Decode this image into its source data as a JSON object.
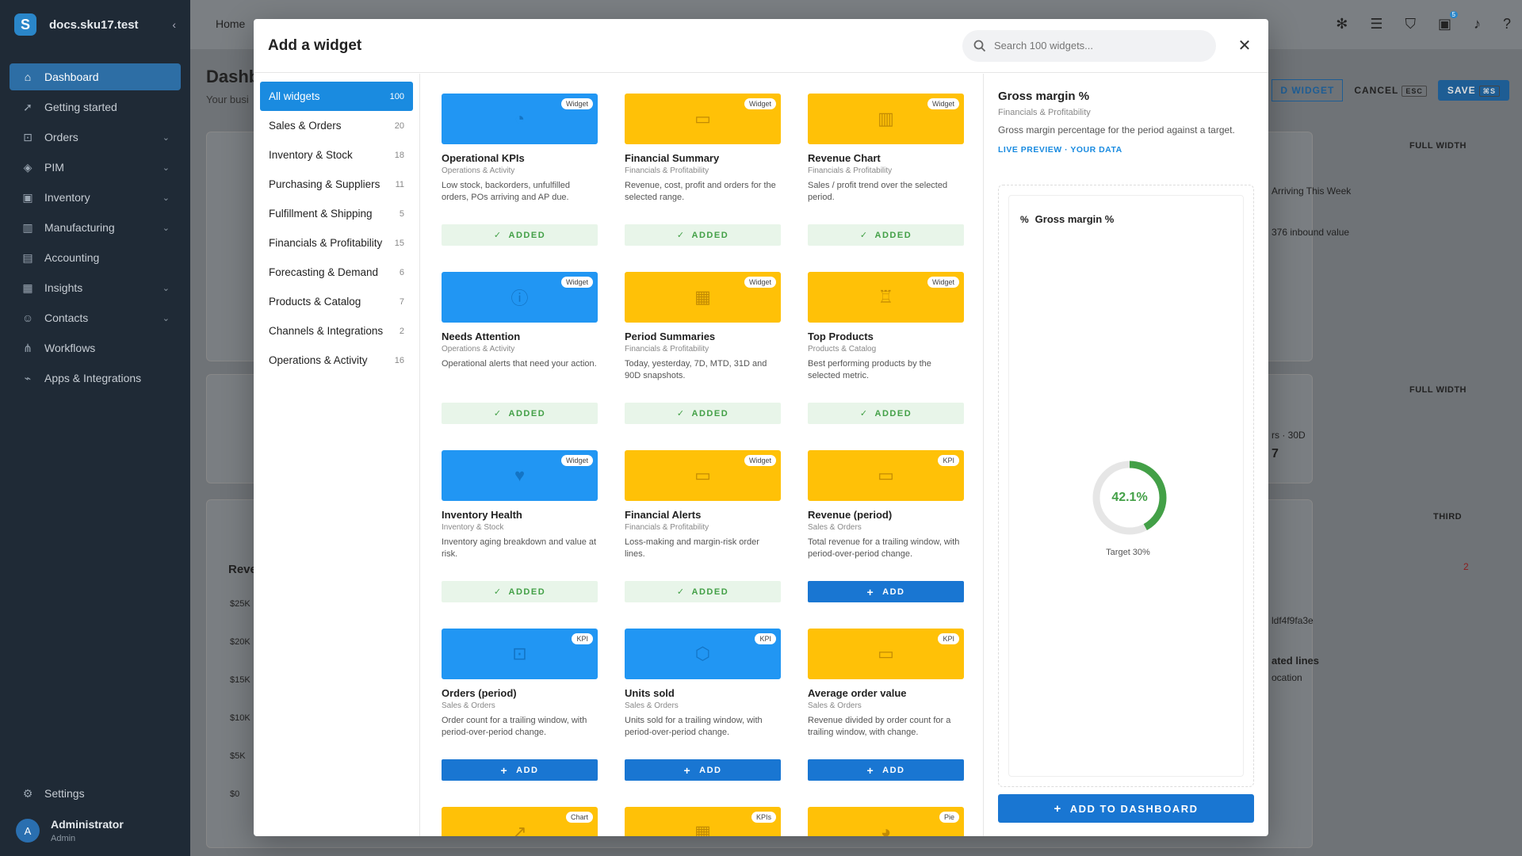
{
  "sidebar": {
    "brand": "docs.sku17.test",
    "items": [
      {
        "label": "Dashboard",
        "icon": "home-icon",
        "glyph": "⌂",
        "chevron": false
      },
      {
        "label": "Getting started",
        "icon": "rocket-icon",
        "glyph": "➚",
        "chevron": false
      },
      {
        "label": "Orders",
        "icon": "cart-icon",
        "glyph": "⊡",
        "chevron": true
      },
      {
        "label": "PIM",
        "icon": "tag-icon",
        "glyph": "◈",
        "chevron": true
      },
      {
        "label": "Inventory",
        "icon": "box-icon",
        "glyph": "▣",
        "chevron": true
      },
      {
        "label": "Manufacturing",
        "icon": "factory-icon",
        "glyph": "▥",
        "chevron": true
      },
      {
        "label": "Accounting",
        "icon": "book-icon",
        "glyph": "▤",
        "chevron": false
      },
      {
        "label": "Insights",
        "icon": "chart-icon",
        "glyph": "▦",
        "chevron": true
      },
      {
        "label": "Contacts",
        "icon": "contacts-icon",
        "glyph": "☺",
        "chevron": true
      },
      {
        "label": "Workflows",
        "icon": "workflow-icon",
        "glyph": "⋔",
        "chevron": false
      },
      {
        "label": "Apps & Integrations",
        "icon": "plug-icon",
        "glyph": "⌁",
        "chevron": false
      }
    ],
    "settings": "Settings",
    "user": {
      "initial": "A",
      "name": "Administrator",
      "role": "Admin"
    }
  },
  "background": {
    "breadcrumb": "Home",
    "title": "Dashb",
    "subtitle": "Your busi",
    "add_widget": "D WIDGET",
    "cancel": "CANCEL",
    "cancel_key": "ESC",
    "save": "SAVE",
    "save_key": "⌘S",
    "full_width": "FULL WIDTH",
    "third": "THIRD",
    "arriving": "Arriving This Week",
    "inbound": "376 inbound value",
    "days": "rs · 30D",
    "digit": "7",
    "rev": "Reve",
    "count": "2",
    "hash": "ldf4f9fa3e",
    "lines": "ated lines",
    "location": "ocation",
    "ticks": [
      "$25K",
      "$20K",
      "$15K",
      "$10K",
      "$5K",
      "$0"
    ]
  },
  "modal": {
    "title": "Add a widget",
    "search_placeholder": "Search 100 widgets...",
    "categories": [
      {
        "label": "All widgets",
        "count": "100",
        "active": true
      },
      {
        "label": "Sales & Orders",
        "count": "20"
      },
      {
        "label": "Inventory & Stock",
        "count": "18"
      },
      {
        "label": "Purchasing & Suppliers",
        "count": "11"
      },
      {
        "label": "Fulfillment & Shipping",
        "count": "5"
      },
      {
        "label": "Financials & Profitability",
        "count": "15"
      },
      {
        "label": "Forecasting & Demand",
        "count": "6"
      },
      {
        "label": "Products & Catalog",
        "count": "7"
      },
      {
        "label": "Channels & Integrations",
        "count": "2"
      },
      {
        "label": "Operations & Activity",
        "count": "16"
      }
    ],
    "widgets": [
      {
        "title": "Operational KPIs",
        "category": "Operations & Activity",
        "desc": "Low stock, backorders, unfulfilled orders, POs arriving and AP due.",
        "tag": "Widget",
        "color": "blue",
        "icon": "gauge-icon",
        "glyph": "◔",
        "status": "added"
      },
      {
        "title": "Financial Summary",
        "category": "Financials & Profitability",
        "desc": "Revenue, cost, profit and orders for the selected range.",
        "tag": "Widget",
        "color": "yellow",
        "icon": "cash-icon",
        "glyph": "▭",
        "status": "added"
      },
      {
        "title": "Revenue Chart",
        "category": "Financials & Profitability",
        "desc": "Sales / profit trend over the selected period.",
        "tag": "Widget",
        "color": "yellow",
        "icon": "bar-chart-icon",
        "glyph": "▥",
        "status": "added"
      },
      {
        "title": "Needs Attention",
        "category": "Operations & Activity",
        "desc": "Operational alerts that need your action.",
        "tag": "Widget",
        "color": "blue",
        "icon": "info-icon",
        "glyph": "ⓘ",
        "status": "added"
      },
      {
        "title": "Period Summaries",
        "category": "Financials & Profitability",
        "desc": "Today, yesterday, 7D, MTD, 31D and 90D snapshots.",
        "tag": "Widget",
        "color": "yellow",
        "icon": "calendar-icon",
        "glyph": "▦",
        "status": "added"
      },
      {
        "title": "Top Products",
        "category": "Products & Catalog",
        "desc": "Best performing products by the selected metric.",
        "tag": "Widget",
        "color": "yellow",
        "icon": "trophy-icon",
        "glyph": "♖",
        "status": "added"
      },
      {
        "title": "Inventory Health",
        "category": "Inventory & Stock",
        "desc": "Inventory aging breakdown and value at risk.",
        "tag": "Widget",
        "color": "blue",
        "icon": "heart-pulse-icon",
        "glyph": "♥",
        "status": "added"
      },
      {
        "title": "Financial Alerts",
        "category": "Financials & Profitability",
        "desc": "Loss-making and margin-risk order lines.",
        "tag": "Widget",
        "color": "yellow",
        "icon": "cash-alert-icon",
        "glyph": "▭",
        "status": "added"
      },
      {
        "title": "Revenue (period)",
        "category": "Sales & Orders",
        "desc": "Total revenue for a trailing window, with period-over-period change.",
        "tag": "KPI",
        "color": "yellow",
        "icon": "cash-icon",
        "glyph": "▭",
        "status": "add"
      },
      {
        "title": "Orders (period)",
        "category": "Sales & Orders",
        "desc": "Order count for a trailing window, with period-over-period change.",
        "tag": "KPI",
        "color": "blue",
        "icon": "cart-icon",
        "glyph": "⊡",
        "status": "add"
      },
      {
        "title": "Units sold",
        "category": "Sales & Orders",
        "desc": "Units sold for a trailing window, with period-over-period change.",
        "tag": "KPI",
        "color": "blue",
        "icon": "cube-icon",
        "glyph": "⬡",
        "status": "add"
      },
      {
        "title": "Average order value",
        "category": "Sales & Orders",
        "desc": "Revenue divided by order count for a trailing window, with change.",
        "tag": "KPI",
        "color": "yellow",
        "icon": "cash-icon",
        "glyph": "▭",
        "status": "add"
      },
      {
        "title": "",
        "category": "",
        "desc": "",
        "tag": "Chart",
        "color": "yellow",
        "icon": "line-chart-icon",
        "glyph": "↗",
        "status": "none"
      },
      {
        "title": "",
        "category": "",
        "desc": "",
        "tag": "KPIs",
        "color": "yellow",
        "icon": "calendar-icon",
        "glyph": "▦",
        "status": "none"
      },
      {
        "title": "",
        "category": "",
        "desc": "",
        "tag": "Pie",
        "color": "yellow",
        "icon": "pie-chart-icon",
        "glyph": "◕",
        "status": "none"
      }
    ],
    "added_label": "ADDED",
    "add_label": "ADD",
    "preview": {
      "title": "Gross margin %",
      "category": "Financials & Profitability",
      "desc": "Gross margin percentage for the period against a target.",
      "live": "LIVE PREVIEW · YOUR DATA",
      "widget_title": "Gross margin %",
      "value": "42.1%",
      "value_fraction": 0.421,
      "target": "Target 30%",
      "add_button": "ADD TO DASHBOARD"
    }
  },
  "colors": {
    "accent": "#1976d2",
    "blue_card": "#2196f3",
    "yellow_card": "#ffc107",
    "added_bg": "#e8f5e9",
    "added_text": "#43a047"
  }
}
